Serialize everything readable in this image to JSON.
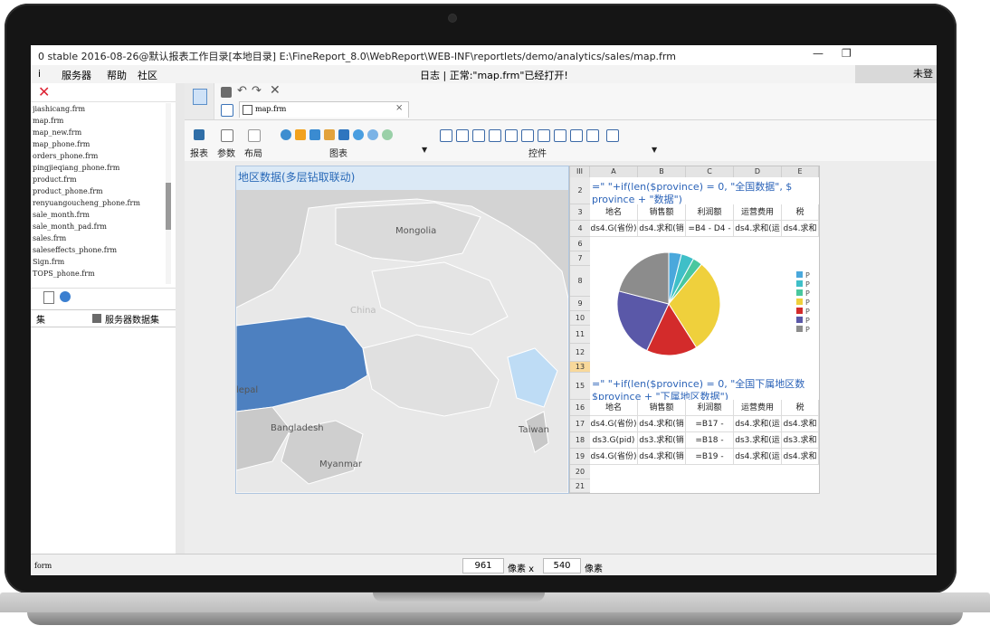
{
  "window": {
    "title": "0 stable 2016-08-26@默认报表工作目录[本地目录]   E:\\FineReport_8.0\\WebReport\\WEB-INF\\reportlets/demo/analytics/sales/map.frm",
    "minimize": "—",
    "restore": "❐"
  },
  "menu": {
    "items": [
      "i",
      "服务器",
      "帮助",
      "社区"
    ],
    "log": "日志 | 正常:\"map.frm\"已经打开!",
    "user": "未登"
  },
  "left_panel": {
    "files": [
      "jiashicang.frm",
      "map.frm",
      "map_new.frm",
      "map_phone.frm",
      "orders_phone.frm",
      "pingjieqiang_phone.frm",
      "product.frm",
      "product_phone.frm",
      "renyuangoucheng_phone.frm",
      "sale_month.frm",
      "sale_month_pad.frm",
      "sales.frm",
      "saleseffects_phone.frm",
      "Sign.frm",
      "TOPS_phone.frm"
    ],
    "selected_file": "map.frm",
    "tab_left": "集",
    "tab_right": "服务器数据集"
  },
  "ribbon": {
    "doc_tab": "map.frm",
    "doc_close": "×",
    "groups": {
      "report": "报表",
      "param": "参数",
      "layout": "布局",
      "chart": "图表",
      "control": "控件"
    }
  },
  "map": {
    "title": "地区数据(多层钻取联动)",
    "labels": {
      "mongolia": "Mongolia",
      "china": "China",
      "nepal": "lepal",
      "bangladesh": "Bangladesh",
      "taiwan": "Taiwan",
      "myanmar": "Myanmar"
    }
  },
  "sheet": {
    "corner": "III",
    "columns": [
      "A",
      "B",
      "C",
      "D",
      "E"
    ],
    "rows": [
      "2",
      "3",
      "4",
      "6",
      "7",
      "8",
      "9",
      "10",
      "11",
      "12",
      "13",
      "15",
      "16",
      "17",
      "18",
      "19",
      "20",
      "21"
    ],
    "formula1": "=\"  \"+if(len($province) = 0, \"全国数据\", $",
    "formula1b": "province + \"数据\")",
    "header1": [
      "地名",
      "销售额",
      "利润额",
      "运营费用",
      "税"
    ],
    "row4": [
      "ds4.G(省份)",
      "ds4.求和(销",
      "=B4 - D4 -",
      "ds4.求和(运",
      "ds4.求和"
    ],
    "formula2": "=\"  \"+if(len($province) = 0, \"全国下属地区数",
    "formula2b": "$province + \"下属地区数据\")",
    "header2": [
      "地名",
      "销售额",
      "利润额",
      "运营费用",
      "税"
    ],
    "row17": [
      "ds4.G(省份)",
      "ds4.求和(销",
      "=B17 -",
      "ds4.求和(运",
      "ds4.求和"
    ],
    "row18": [
      "ds3.G(pid)",
      "ds3.求和(销",
      "=B18 -",
      "ds3.求和(运",
      "ds3.求和"
    ],
    "row19": [
      "ds4.G(省份)",
      "ds4.求和(销",
      "=B19 -",
      "ds4.求和(运",
      "ds4.求和"
    ],
    "legend_label": "P"
  },
  "chart_data": {
    "type": "pie",
    "values": [
      4,
      4,
      3,
      30,
      16,
      22,
      21
    ],
    "colors": [
      "#4aa8dc",
      "#3fbfc8",
      "#49c79e",
      "#efd03c",
      "#d32b2b",
      "#5a58a8",
      "#8c8c8c"
    ]
  },
  "status": {
    "label": "form",
    "width": "961",
    "unit1": "像素 x",
    "height": "540",
    "unit2": "像素"
  }
}
